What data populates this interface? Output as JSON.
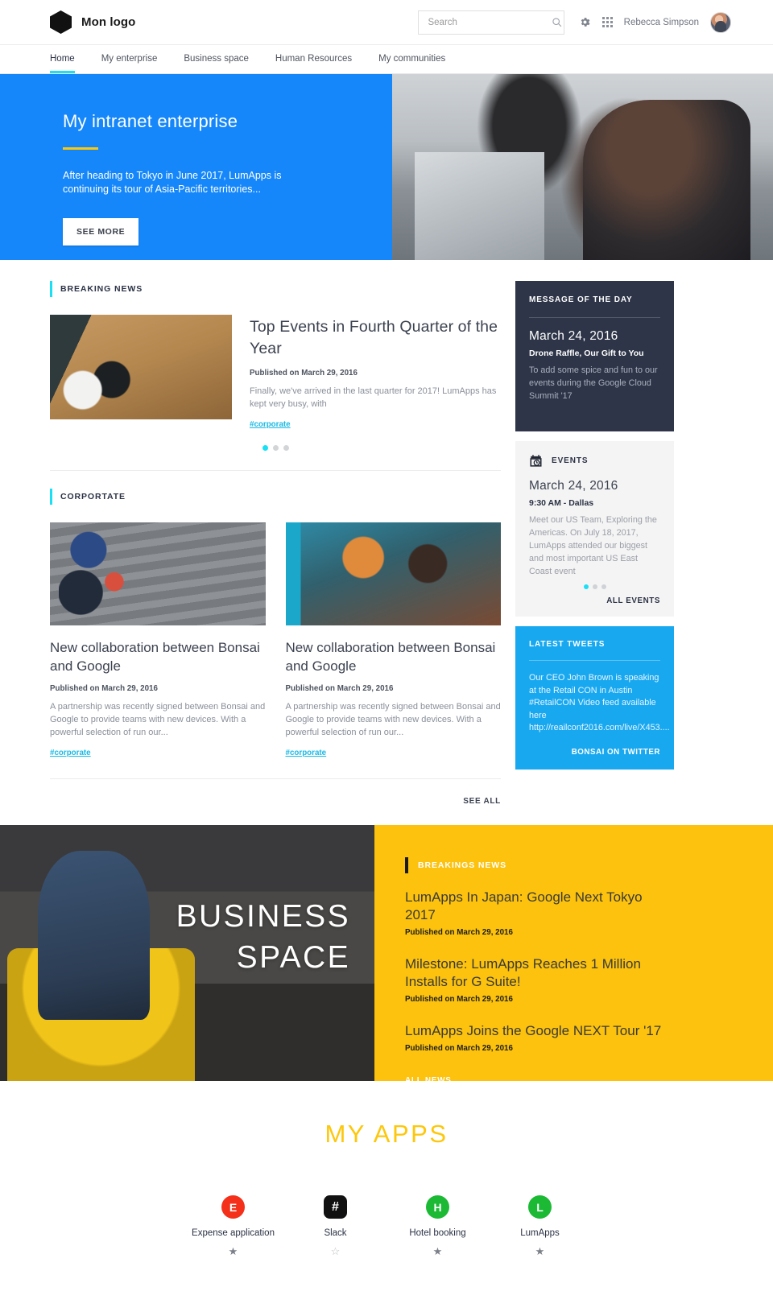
{
  "topbar": {
    "brand_name": "Mon logo",
    "search_placeholder": "Search",
    "search_value": "",
    "user_name": "Rebecca Simpson",
    "icons": {
      "search": "search-icon",
      "settings": "gear-icon",
      "apps": "app-grid-icon",
      "avatar": "avatar"
    }
  },
  "nav": {
    "items": [
      {
        "label": "Home",
        "active": true
      },
      {
        "label": "My enterprise",
        "active": false
      },
      {
        "label": "Business space",
        "active": false
      },
      {
        "label": "Human Resources",
        "active": false
      },
      {
        "label": "My communities",
        "active": false
      }
    ],
    "active_color": "#19e0f5"
  },
  "hero": {
    "title": "My intranet enterprise",
    "description": "After heading to Tokyo in June 2017, LumApps is continuing its tour of Asia-Pacific territories...",
    "button_label": "SEE MORE",
    "bg_color": "#1587fa",
    "rule_color": "#fdc70b"
  },
  "breaking_news": {
    "label": "BREAKING NEWS",
    "article": {
      "title": "Top Events in Fourth Quarter of the Year",
      "published": "Published on March 29, 2016",
      "excerpt": "Finally, we've arrived in the last quarter for 2017! LumApps has kept very busy, with",
      "tag": "#corporate"
    },
    "carousel": {
      "total": 3,
      "active": 1
    }
  },
  "corporate": {
    "label": "CORPORTATE",
    "cards": [
      {
        "title": "New collaboration between Bonsai and Google",
        "published": "Published on March 29, 2016",
        "excerpt": "A partnership was recently signed between Bonsai and Google to provide teams with new devices. With a powerful selection of run our...",
        "tag": "#corporate"
      },
      {
        "title": "New collaboration between Bonsai and Google",
        "published": "Published on March 29, 2016",
        "excerpt": "A partnership was recently signed between Bonsai and Google to provide teams with new devices. With a powerful selection of run our...",
        "tag": "#corporate"
      }
    ],
    "see_all_label": "SEE ALL"
  },
  "sidebar": {
    "message_of_the_day": {
      "title": "MESSAGE OF THE DAY",
      "date": "March 24, 2016",
      "subtitle": "Drone Raffle, Our Gift to You",
      "text": "To add some spice and fun to our events during the Google Cloud Summit '17",
      "bg_color": "#2e3548"
    },
    "events": {
      "title": "EVENTS",
      "date": "March 24, 2016",
      "subtitle": "9:30 AM - Dallas",
      "text": "Meet our US Team, Exploring the Americas. On July 18, 2017, LumApps attended our biggest and most important US East Coast event",
      "all_label": "ALL EVENTS",
      "carousel": {
        "total": 3,
        "active": 1
      },
      "bg_color": "#f4f4f4"
    },
    "tweets": {
      "title": "LATEST TWEETS",
      "text": "Our CEO John Brown is speaking at the Retail CON in Austin #RetailCON\nVideo feed available here http://reailconf2016.com/live/X453....",
      "link_label": "BONSAI ON TWITTER",
      "bg_color": "#18a8f0"
    }
  },
  "business_space": {
    "caption_line1": "BUSINESS",
    "caption_line2": "SPACE",
    "label": "BREAKINGS NEWS",
    "bg_color": "#fcc20d",
    "items": [
      {
        "title": "LumApps In Japan: Google Next Tokyo 2017",
        "published": "Published on March 29, 2016"
      },
      {
        "title": "Milestone: LumApps Reaches 1 Million Installs for G Suite!",
        "published": "Published on March 29, 2016"
      },
      {
        "title": "LumApps Joins the Google NEXT Tour '17",
        "published": "Published on March 29, 2016"
      }
    ],
    "all_news_label": "ALL NEWS"
  },
  "my_apps": {
    "title": "MY APPS",
    "items": [
      {
        "name": "Expense application",
        "letter": "E",
        "color": "#f4301a",
        "starred": true,
        "star_glyph": "★"
      },
      {
        "name": "Slack",
        "letter": "#",
        "color": "#111111",
        "starred": false,
        "star_glyph": "☆"
      },
      {
        "name": "Hotel booking",
        "letter": "H",
        "color": "#1bb934",
        "starred": true,
        "star_glyph": "★"
      },
      {
        "name": "LumApps",
        "letter": "L",
        "color": "#1bb934",
        "starred": true,
        "star_glyph": "★"
      }
    ]
  }
}
